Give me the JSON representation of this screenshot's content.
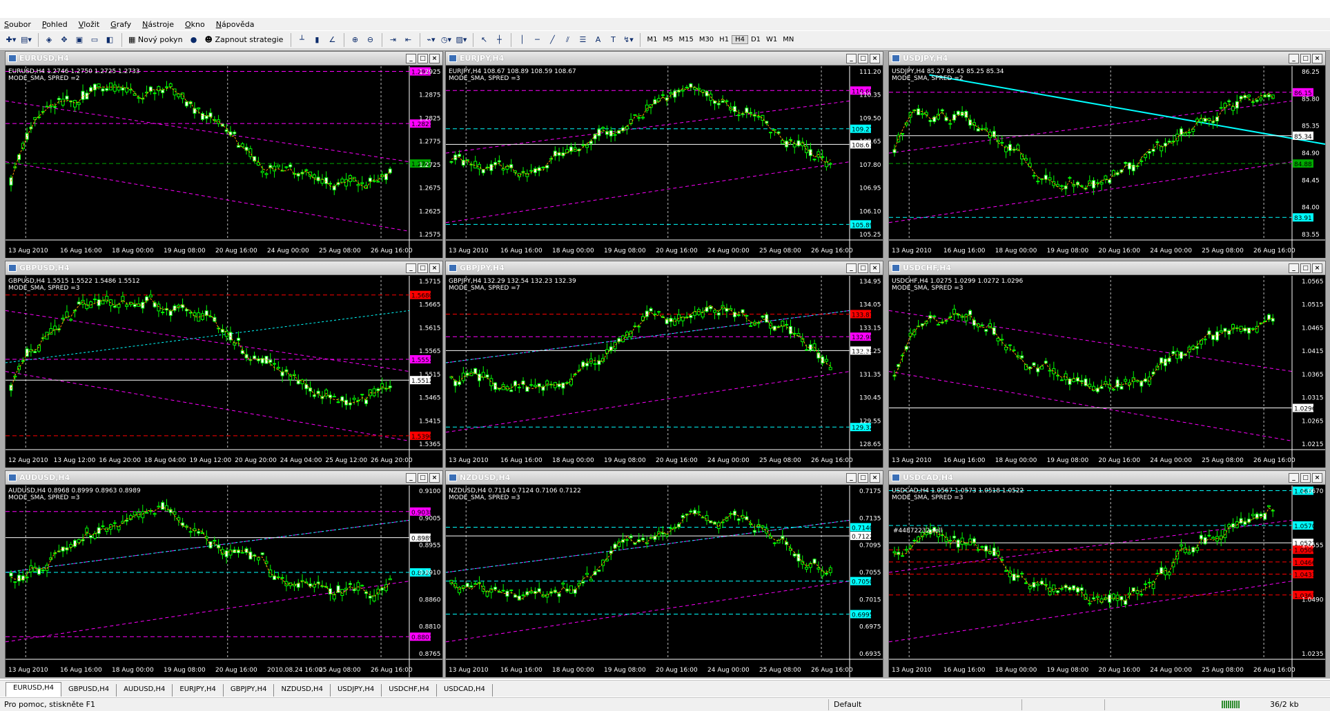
{
  "menu": [
    "Soubor",
    "Pohled",
    "Vložit",
    "Grafy",
    "Nástroje",
    "Okno",
    "Nápověda"
  ],
  "toolbar": {
    "new_order": "Nový pokyn",
    "autotrading": "Zapnout strategie",
    "timeframes": [
      "M1",
      "M5",
      "M15",
      "M30",
      "H1",
      "H4",
      "D1",
      "W1",
      "MN"
    ],
    "active_timeframe": "H4"
  },
  "colors": {
    "bg": "#000000",
    "candle": "#00ff00",
    "bull_body": "#ffffff",
    "magenta": "#ff00ff",
    "cyan": "#00ffff",
    "green": "#00aa00",
    "red": "#ff0000",
    "orange": "#ff9900",
    "grid": "#808080"
  },
  "windows": [
    {
      "title": "EURUSD,H4",
      "info1": "EURUSD,H4  1.2746 1.2750 1.2725 1.2733",
      "info2": "MODE_SMA, SPRED =2",
      "prices": [
        "1.2925",
        "1.2875",
        "1.2825",
        "1.2775",
        "1.2725",
        "1.2675",
        "1.2625",
        "1.2575"
      ],
      "times": [
        "13 Aug 2010",
        "16 Aug 16:00",
        "18 Aug 00:00",
        "19 Aug 08:00",
        "20 Aug 16:00",
        "24 Aug 00:00",
        "25 Aug 08:00",
        "26 Aug 16:00"
      ],
      "hlabels": [
        {
          "text": "1.2925",
          "color": "#ff00ff",
          "y": 0.03
        },
        {
          "text": "1.2821",
          "color": "#ff00ff",
          "y": 0.33
        },
        {
          "text": "1.2740",
          "color": "#00aa00",
          "y": 0.56
        }
      ],
      "trend": -1
    },
    {
      "title": "EURJPY,H4",
      "info1": "EURJPY,H4  108.67 108.89 108.59 108.67",
      "info2": "MODE_SMA, SPRED =3",
      "prices": [
        "111.20",
        "110.35",
        "109.50",
        "108.65",
        "107.80",
        "106.95",
        "106.10",
        "105.25"
      ],
      "times": [
        "13 Aug 2010",
        "16 Aug 16:00",
        "18 Aug 00:00",
        "19 Aug 08:00",
        "20 Aug 16:00",
        "24 Aug 00:00",
        "25 Aug 08:00",
        "26 Aug 16:00"
      ],
      "hlabels": [
        {
          "text": "110.68",
          "color": "#ff00ff",
          "y": 0.14
        },
        {
          "text": "109.27",
          "color": "#00ffff",
          "y": 0.36
        },
        {
          "text": "108.67",
          "color": "#ffffff",
          "y": 0.45
        },
        {
          "text": "105.89",
          "color": "#00ffff",
          "y": 0.91
        }
      ],
      "trend": 0
    },
    {
      "title": "USDJPY,H4",
      "info1": "USDJPY,H4  85.27 85.45 85.25 85.34",
      "info2": "MODE_SMA, SPRED =2",
      "prices": [
        "86.25",
        "85.80",
        "85.35",
        "84.90",
        "84.45",
        "84.00",
        "83.55"
      ],
      "times": [
        "13 Aug 2010",
        "16 Aug 16:00",
        "18 Aug 00:00",
        "19 Aug 08:00",
        "20 Aug 16:00",
        "24 Aug 00:00",
        "25 Aug 08:00",
        "26 Aug 16:00"
      ],
      "hlabels": [
        {
          "text": "86.15",
          "color": "#ff00ff",
          "y": 0.15
        },
        {
          "text": "85.34",
          "color": "#ffffff",
          "y": 0.4
        },
        {
          "text": "84.88",
          "color": "#00aa00",
          "y": 0.56
        },
        {
          "text": "83.91",
          "color": "#00ffff",
          "y": 0.87
        }
      ],
      "trend": 0
    },
    {
      "title": "GBPUSD,H4",
      "info1": "GBPUSD,H4  1.5515 1.5522 1.5486 1.5512",
      "info2": "MODE_SMA, SPRED =3",
      "prices": [
        "1.5715",
        "1.5665",
        "1.5615",
        "1.5565",
        "1.5515",
        "1.5465",
        "1.5415",
        "1.5365"
      ],
      "times": [
        "12 Aug 2010",
        "13 Aug 12:00",
        "16 Aug 20:00",
        "18 Aug 04:00",
        "19 Aug 12:00",
        "20 Aug 20:00",
        "24 Aug 04:00",
        "25 Aug 12:00",
        "26 Aug 20:00"
      ],
      "hlabels": [
        {
          "text": "1.5680",
          "color": "#ff0000",
          "y": 0.11
        },
        {
          "text": "1.5551",
          "color": "#ff00ff",
          "y": 0.48
        },
        {
          "text": "1.5512",
          "color": "#ffffff",
          "y": 0.6
        },
        {
          "text": "1.5390",
          "color": "#ff0000",
          "y": 0.92
        }
      ],
      "trend": -1
    },
    {
      "title": "GBPJPY,H4",
      "info1": "GBPJPY,H4  132.29 132.54 132.23 132.39",
      "info2": "MODE_SMA, SPRED =7",
      "prices": [
        "134.95",
        "134.05",
        "133.15",
        "132.25",
        "131.35",
        "130.45",
        "129.55",
        "128.65"
      ],
      "times": [
        "13 Aug 2010",
        "16 Aug 16:00",
        "18 Aug 00:00",
        "19 Aug 08:00",
        "20 Aug 16:00",
        "24 Aug 00:00",
        "25 Aug 08:00",
        "26 Aug 16:00"
      ],
      "hlabels": [
        {
          "text": "133.87",
          "color": "#ff0000",
          "y": 0.22
        },
        {
          "text": "132.98",
          "color": "#ff00ff",
          "y": 0.35
        },
        {
          "text": "132.39",
          "color": "#ffffff",
          "y": 0.43
        },
        {
          "text": "129.32",
          "color": "#00ffff",
          "y": 0.87
        }
      ],
      "trend": 0
    },
    {
      "title": "USDCHF,H4",
      "info1": "USDCHF,H4  1.0275 1.0299 1.0272 1.0296",
      "info2": "MODE_SMA, SPRED =3",
      "prices": [
        "1.0565",
        "1.0515",
        "1.0465",
        "1.0415",
        "1.0365",
        "1.0315",
        "1.0265",
        "1.0215"
      ],
      "times": [
        "13 Aug 2010",
        "16 Aug 16:00",
        "18 Aug 00:00",
        "19 Aug 08:00",
        "20 Aug 16:00",
        "24 Aug 00:00",
        "25 Aug 08:00",
        "26 Aug 16:00"
      ],
      "hlabels": [
        {
          "text": "1.0296",
          "color": "#ffffff",
          "y": 0.76
        }
      ],
      "trend": -1
    },
    {
      "title": "AUDUSD,H4",
      "info1": "AUDUSD,H4  0.8968 0.8999 0.8963 0.8989",
      "info2": "MODE_SMA, SPRED =3",
      "prices": [
        "0.9100",
        "0.9005",
        "0.8955",
        "0.8910",
        "0.8860",
        "0.8810",
        "0.8765"
      ],
      "times": [
        "13 Aug 2010",
        "16 Aug 16:00",
        "18 Aug 00:00",
        "19 Aug 08:00",
        "20 Aug 16:00",
        "2010.08.24 16:00",
        "25 Aug 08:00",
        "26 Aug 16:00"
      ],
      "hlabels": [
        {
          "text": "0.9038",
          "color": "#ff00ff",
          "y": 0.15
        },
        {
          "text": "0.8989",
          "color": "#ffffff",
          "y": 0.3
        },
        {
          "text": "0.8920",
          "color": "#00ffff",
          "y": 0.5
        },
        {
          "text": "0.8801",
          "color": "#ff00ff",
          "y": 0.87
        }
      ],
      "trend": 0
    },
    {
      "title": "NZDUSD,H4",
      "info1": "NZDUSD,H4  0.7114 0.7124 0.7106 0.7122",
      "info2": "MODE_SMA, SPRED =3",
      "prices": [
        "0.7175",
        "0.7135",
        "0.7095",
        "0.7055",
        "0.7015",
        "0.6975",
        "0.6935"
      ],
      "times": [
        "13 Aug 2010",
        "16 Aug 16:00",
        "18 Aug 00:00",
        "19 Aug 08:00",
        "20 Aug 16:00",
        "24 Aug 00:00",
        "25 Aug 08:00",
        "26 Aug 16:00"
      ],
      "hlabels": [
        {
          "text": "0.7140",
          "color": "#00ffff",
          "y": 0.24
        },
        {
          "text": "0.7122",
          "color": "#ffffff",
          "y": 0.29
        },
        {
          "text": "0.7050",
          "color": "#00ffff",
          "y": 0.55
        },
        {
          "text": "0.6995",
          "color": "#00ffff",
          "y": 0.74
        }
      ],
      "trend": 0
    },
    {
      "title": "USDCAD,H4",
      "info1": "USDCAD,H4  1.0567 1.0573 1.0518 1.0522",
      "info2": "MODE_SMA, SPRED =3",
      "order": "#44872232 sell",
      "prices": [
        "1.0670",
        "1.0555",
        "1.0490",
        "1.0235"
      ],
      "times": [
        "13 Aug 2010",
        "16 Aug 16:00",
        "18 Aug 00:00",
        "19 Aug 08:00",
        "20 Aug 16:00",
        "24 Aug 00:00",
        "25 Aug 08:00",
        "26 Aug 16:00"
      ],
      "hlabels": [
        {
          "text": "1.0670",
          "color": "#00ffff",
          "y": 0.03
        },
        {
          "text": "1.0570",
          "color": "#00ffff",
          "y": 0.23
        },
        {
          "text": "1.0522",
          "color": "#ffffff",
          "y": 0.33
        },
        {
          "text": "1.0506",
          "color": "#ff0000",
          "y": 0.37
        },
        {
          "text": "1.0466",
          "color": "#ff0000",
          "y": 0.44
        },
        {
          "text": "1.0433",
          "color": "#ff0000",
          "y": 0.51
        },
        {
          "text": "1.0363",
          "color": "#ff0000",
          "y": 0.63
        }
      ],
      "trend": 1
    }
  ],
  "tabs": [
    "EURUSD,H4",
    "GBPUSD,H4",
    "AUDUSD,H4",
    "EURJPY,H4",
    "GBPJPY,H4",
    "NZDUSD,H4",
    "USDJPY,H4",
    "USDCHF,H4",
    "USDCAD,H4"
  ],
  "active_tab": "EURUSD,H4",
  "status": {
    "help": "Pro pomoc, stiskněte F1",
    "profile": "Default",
    "traffic": "36/2 kb"
  }
}
